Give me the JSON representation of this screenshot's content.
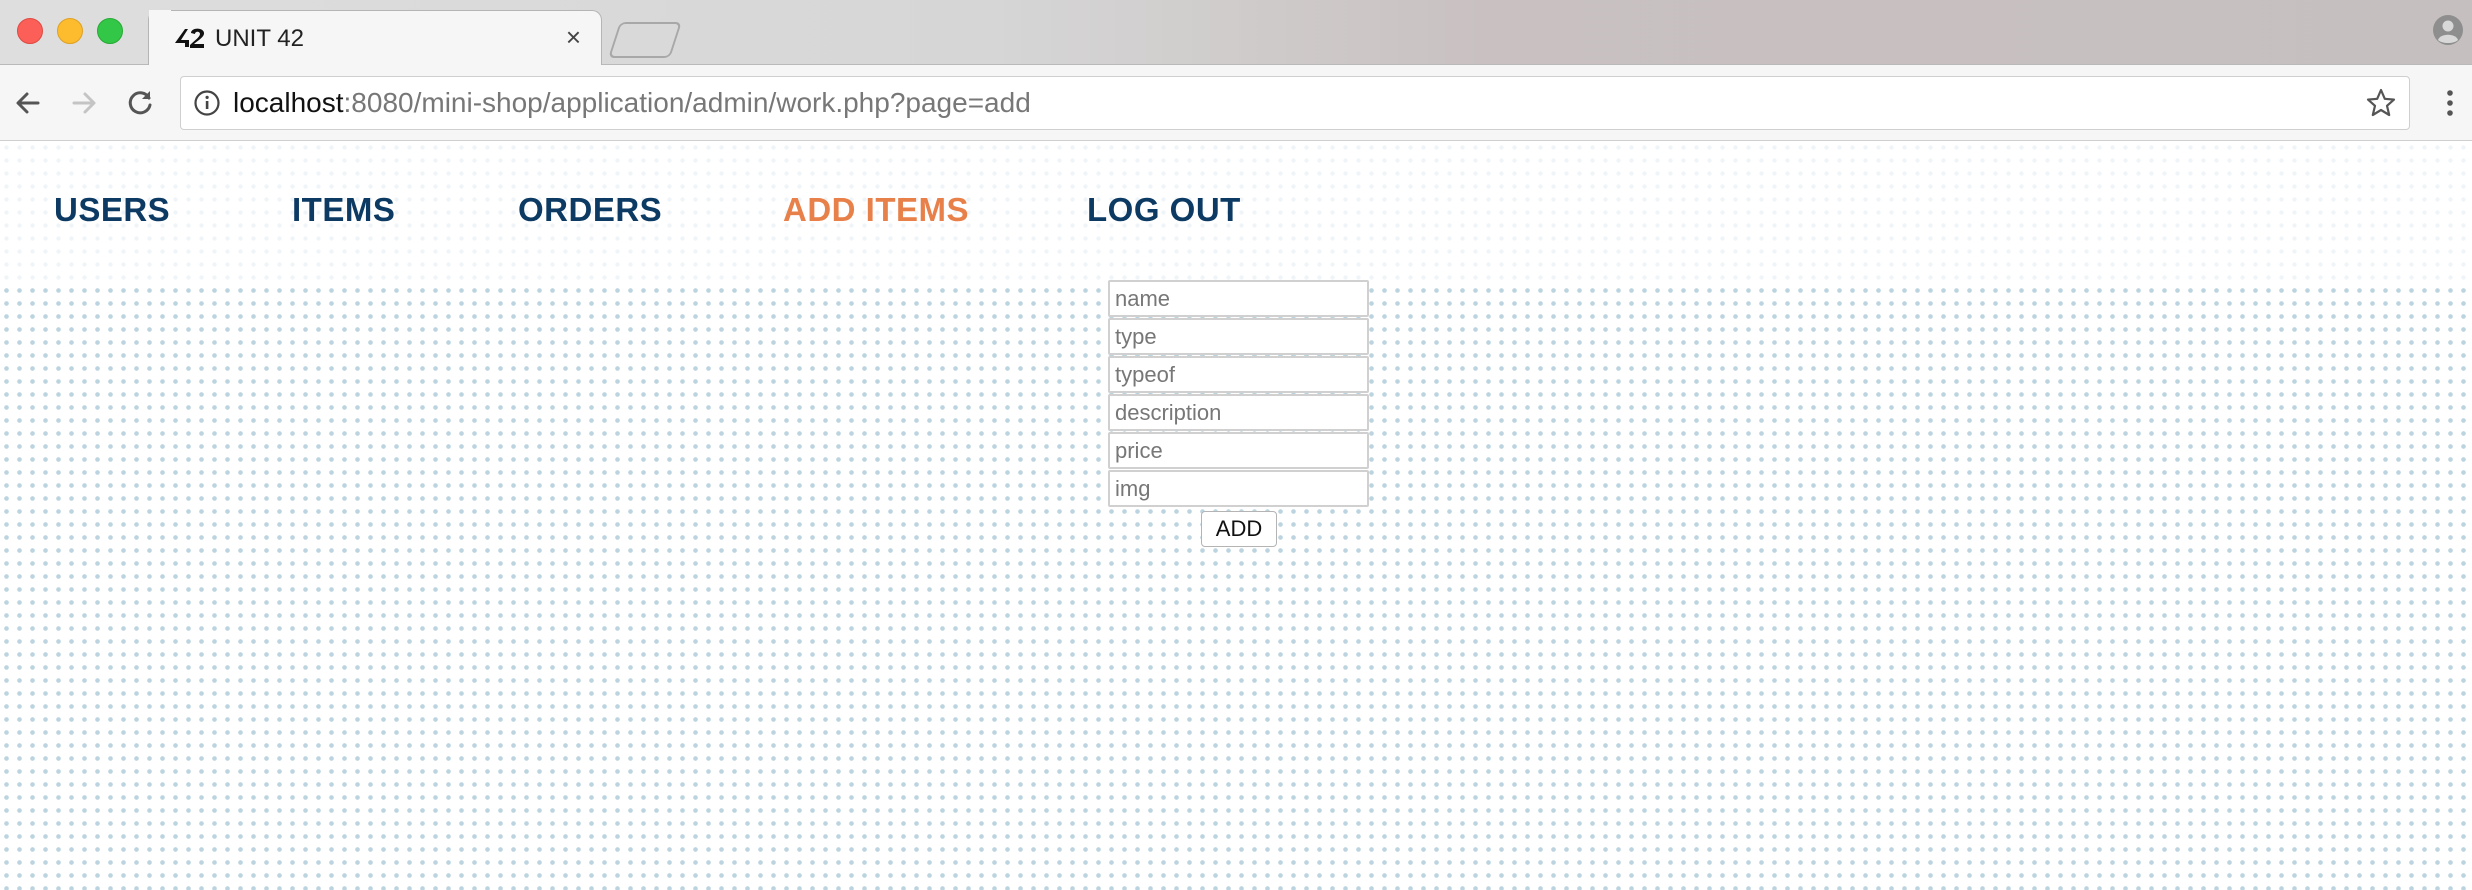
{
  "browser": {
    "tab": {
      "title": "UNIT 42",
      "close_glyph": "×",
      "favicon": "unit42-logo-icon"
    },
    "address_bar": {
      "host": "localhost",
      "path": ":8080/mini-shop/application/admin/work.php?page=add"
    },
    "icons": {
      "back": "arrow-left-icon",
      "forward": "arrow-right-icon",
      "reload": "reload-icon",
      "info": "info-icon",
      "bookmark": "star-icon",
      "menu": "vertical-dots-icon",
      "profile": "profile-icon"
    }
  },
  "nav": {
    "items": [
      {
        "label": "USERS"
      },
      {
        "label": "ITEMS"
      },
      {
        "label": "ORDERS"
      },
      {
        "label": "ADD ITEMS",
        "active": true
      },
      {
        "label": "LOG OUT"
      }
    ]
  },
  "form": {
    "fields": [
      {
        "placeholder": "name",
        "value": ""
      },
      {
        "placeholder": "type",
        "value": ""
      },
      {
        "placeholder": "typeof",
        "value": ""
      },
      {
        "placeholder": "description",
        "value": ""
      },
      {
        "placeholder": "price",
        "value": ""
      },
      {
        "placeholder": "img",
        "value": ""
      }
    ],
    "submit_label": "ADD"
  },
  "colors": {
    "nav_link": "#0c3a63",
    "nav_active": "#e8804a",
    "dot_pattern": "#bcd4e0"
  }
}
